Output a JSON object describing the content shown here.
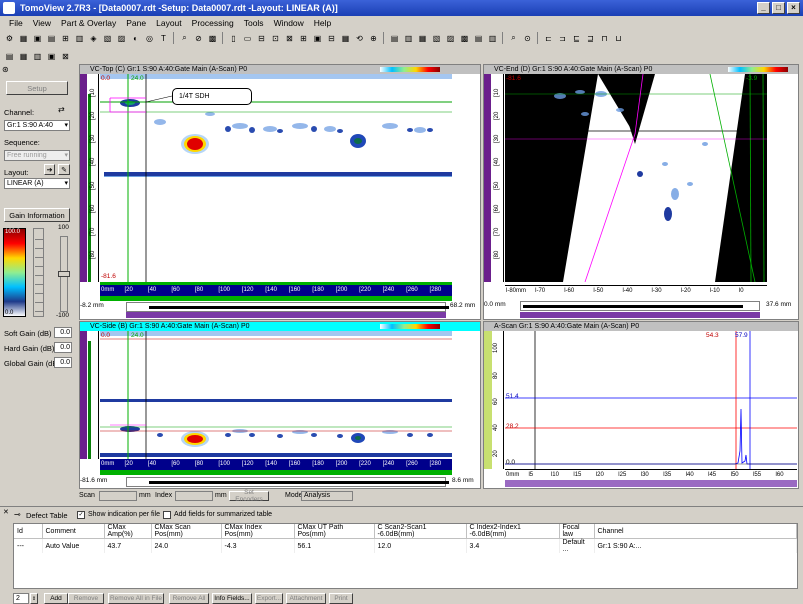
{
  "app": {
    "title": "TomoView 2.7R3 - [Data0007.rdt -Setup: Data0007.rdt -Layout: LINEAR (A)]"
  },
  "menu": [
    "File",
    "View",
    "Part & Overlay",
    "Pane",
    "Layout",
    "Processing",
    "Tools",
    "Window",
    "Help"
  ],
  "left": {
    "setup": "Setup",
    "channel_label": "Channel:",
    "channel_value": "Gr:1 S:90 A:40",
    "sequence_label": "Sequence:",
    "sequence_value": "Free running",
    "layout_label": "Layout:",
    "layout_value": "LINEAR (A)",
    "gain_info": "Gain Information",
    "palette_top": "100.0",
    "palette_bottom": "0.0",
    "scale_top": "100",
    "scale_bottom": "-100",
    "soft_gain_label": "Soft Gain (dB)",
    "soft_gain": "0.0",
    "hard_gain_label": "Hard Gain (dB)",
    "hard_gain": "0.0",
    "global_gain_label": "Global Gain (dB)",
    "global_gain": "0.0"
  },
  "pane_top": {
    "title": "VC-Top (C) Gr:1 S:90 A:40:Gate Main (A-Scan) P0",
    "callout": "1/4T SDH",
    "top_val": "0.0",
    "cursor_val": "24.0",
    "bottom_val": "-81.6",
    "y_ticks": [
      "[10",
      "[20",
      "[30",
      "[40",
      "[50",
      "[60",
      "[70",
      "[80"
    ],
    "x_ticks": [
      "0mm",
      "[20",
      "[40",
      "[60",
      "[80",
      "[100",
      "[120",
      "[140",
      "[160",
      "[180",
      "[200",
      "[220",
      "[240",
      "[260",
      "[280"
    ],
    "left_readout": "-8.2 mm",
    "right_readout": "68.2 mm"
  },
  "pane_end": {
    "title": "VC-End (D) Gr:1 S:90 A:40:Gate Main (A-Scan) P0",
    "top_left": "-81.6",
    "top_right": "-3.9",
    "y_ticks": [
      "[10",
      "[20",
      "[30",
      "[40",
      "[50",
      "[60",
      "[70",
      "[80"
    ],
    "x_ticks": [
      "l-80mm",
      "l-70",
      "l-60",
      "l-50",
      "l-40",
      "l-30",
      "l-20",
      "l-10",
      "l0"
    ],
    "left_readout": "0.0 mm",
    "right_readout": "37.6 mm"
  },
  "pane_side": {
    "title": "VC-Side (B) Gr:1 S:90 A:40:Gate Main (A-Scan) P0",
    "top_val": "0.0",
    "cursor_val": "24.0",
    "bottom_val": "-81.6",
    "x_ticks": [
      "0mm",
      "[20",
      "[40",
      "[60",
      "[80",
      "[100",
      "[120",
      "[140",
      "[160",
      "[180",
      "[200",
      "[220",
      "[240",
      "[260",
      "[280"
    ],
    "left_readout": "-81.6 mm",
    "right_readout": "8.6 mm"
  },
  "pane_ascan": {
    "title": "A-Scan Gr:1 S:90 A:40:Gate Main (A-Scan) P0",
    "cursor_a": "54.3",
    "cursor_b": "57.9",
    "level_a": "51.4",
    "level_b": "28.2",
    "zero": "0.0",
    "y_ticks": [
      "100",
      "80",
      "60",
      "40",
      "20"
    ],
    "x_ticks": [
      "0mm",
      "l5",
      "l10",
      "l15",
      "l20",
      "l25",
      "l30",
      "l35",
      "l40",
      "l45",
      "l50",
      "l55",
      "l60"
    ]
  },
  "status": {
    "scan_label": "Scan",
    "scan_unit": "mm",
    "index_label": "Index",
    "index_unit": "mm",
    "set_encoder": "Set Encoders",
    "mode_label": "Mode",
    "mode_value": "Analysis"
  },
  "defect": {
    "title": "Defect Table",
    "show_indication": "Show indication per file",
    "add_fields": "Add fields for summarized table",
    "columns": [
      "Id",
      "Comment",
      "CMax Amp(%)",
      "CMax Scan Pos(mm)",
      "CMax Index Pos(mm)",
      "CMax UT Path Pos(mm)",
      "C Scan2-Scan1 -6.0dB(mm)",
      "C Index2-Index1 -6.0dB(mm)",
      "Focal law",
      "Channel"
    ],
    "rows": [
      [
        "---",
        "Auto Value",
        "43.7",
        "24.0",
        "-4.3",
        "56.1",
        "12.0",
        "3.4",
        "Default ...",
        "Gr:1 S:90 A:..."
      ]
    ],
    "count": "2",
    "buttons": [
      "Add",
      "Remove",
      "Remove All in File",
      "Remove All",
      "Info Fields...",
      "Export...",
      "Attachment",
      "Print"
    ]
  }
}
